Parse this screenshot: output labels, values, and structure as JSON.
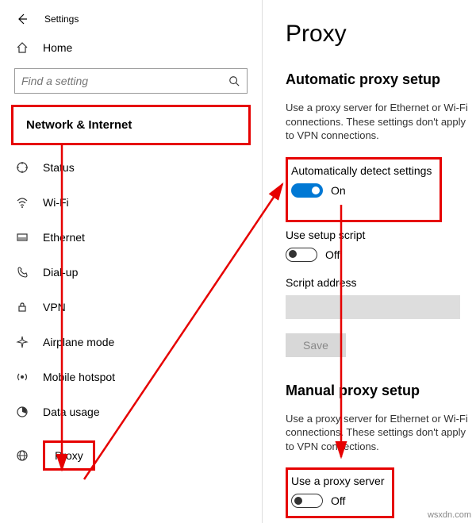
{
  "window": {
    "title": "Settings"
  },
  "sidebar": {
    "home": "Home",
    "search_placeholder": "Find a setting",
    "category": "Network & Internet",
    "items": [
      {
        "label": "Status"
      },
      {
        "label": "Wi-Fi"
      },
      {
        "label": "Ethernet"
      },
      {
        "label": "Dial-up"
      },
      {
        "label": "VPN"
      },
      {
        "label": "Airplane mode"
      },
      {
        "label": "Mobile hotspot"
      },
      {
        "label": "Data usage"
      },
      {
        "label": "Proxy"
      }
    ]
  },
  "content": {
    "title": "Proxy",
    "auto": {
      "heading": "Automatic proxy setup",
      "desc": "Use a proxy server for Ethernet or Wi-Fi connections. These settings don't apply to VPN connections.",
      "detect_label": "Automatically detect settings",
      "detect_state": "On",
      "script_label": "Use setup script",
      "script_state": "Off",
      "address_label": "Script address",
      "address_value": "",
      "save_label": "Save"
    },
    "manual": {
      "heading": "Manual proxy setup",
      "desc": "Use a proxy server for Ethernet or Wi-Fi connections. These settings don't apply to VPN connections.",
      "use_label": "Use a proxy server",
      "use_state": "Off"
    }
  },
  "watermark": "wsxdn.com"
}
